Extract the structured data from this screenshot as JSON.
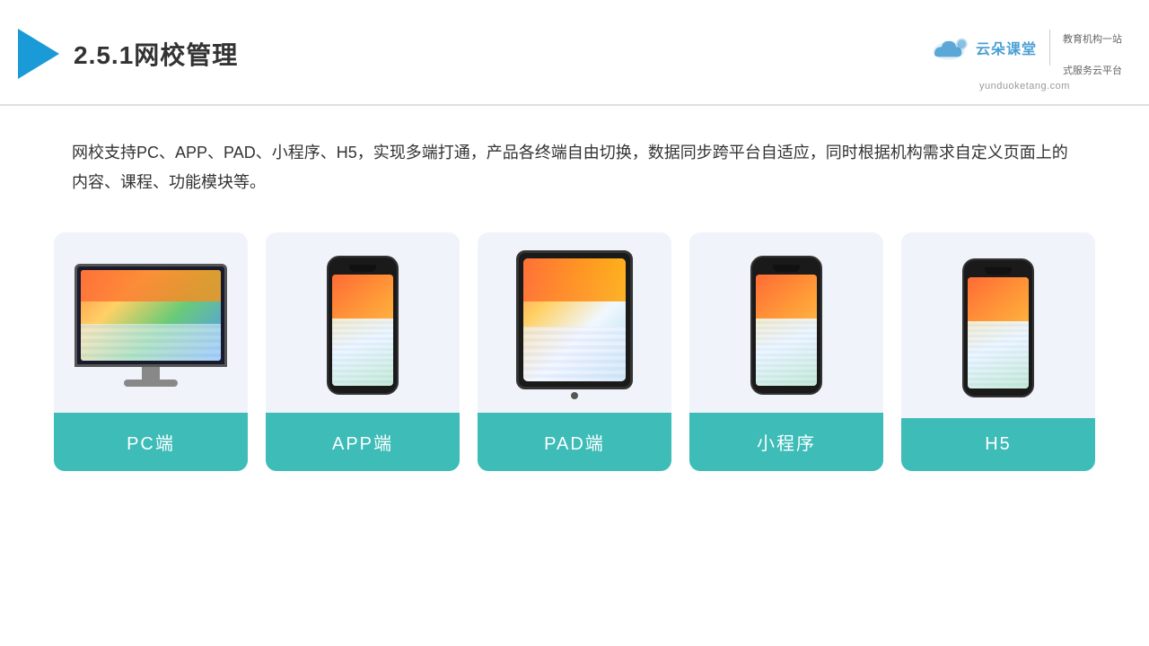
{
  "header": {
    "title": "2.5.1网校管理",
    "brand_name": "云朵课堂",
    "brand_url": "yunduoketang.com",
    "tagline_line1": "教育机构一站",
    "tagline_line2": "式服务云平台"
  },
  "description": {
    "text": "网校支持PC、APP、PAD、小程序、H5，实现多端打通，产品各终端自由切换，数据同步跨平台自适应，同时根据机构需求自定义页面上的内容、课程、功能模块等。"
  },
  "cards": [
    {
      "id": "pc",
      "label": "PC端"
    },
    {
      "id": "app",
      "label": "APP端"
    },
    {
      "id": "pad",
      "label": "PAD端"
    },
    {
      "id": "mini",
      "label": "小程序"
    },
    {
      "id": "h5",
      "label": "H5"
    }
  ]
}
